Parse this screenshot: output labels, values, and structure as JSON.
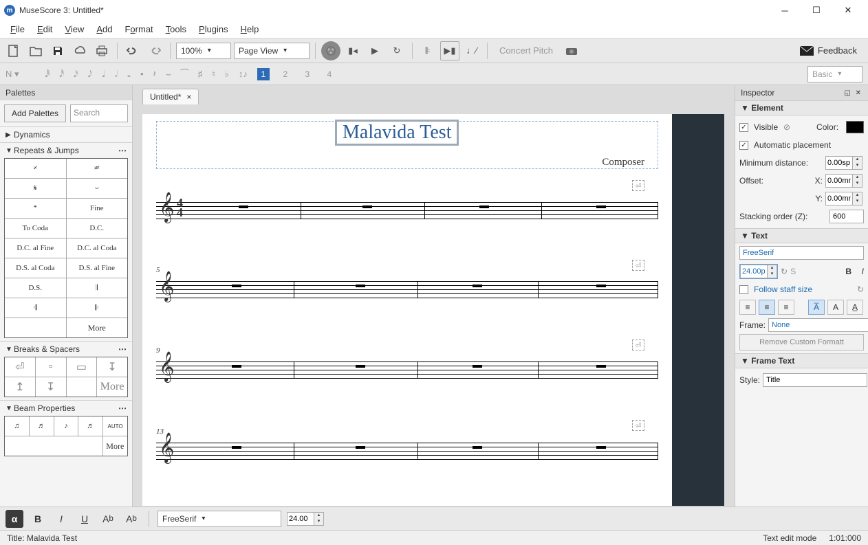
{
  "title": "MuseScore 3: Untitled*",
  "menu": [
    "File",
    "Edit",
    "View",
    "Add",
    "Format",
    "Tools",
    "Plugins",
    "Help"
  ],
  "zoom": "100%",
  "viewMode": "Page View",
  "concertPitch": "Concert Pitch",
  "feedback": "Feedback",
  "noteStyle": "Basic",
  "voices": [
    "1",
    "2",
    "3",
    "4"
  ],
  "tabs": [
    {
      "label": "Untitled*"
    }
  ],
  "score": {
    "title": "Malavida Test",
    "composer": "Composer",
    "staves": [
      {
        "num": "",
        "timesig": true
      },
      {
        "num": "5"
      },
      {
        "num": "9"
      },
      {
        "num": "13"
      }
    ]
  },
  "palettes": {
    "title": "Palettes",
    "addBtn": "Add Palettes",
    "searchPlaceholder": "Search",
    "dynamics": "Dynamics",
    "repeats": {
      "title": "Repeats & Jumps",
      "cells": [
        [
          "𝄎",
          "𝄏"
        ],
        [
          "𝄋",
          "𝄑"
        ],
        [
          "𝄌",
          "Fine"
        ],
        [
          "To Coda",
          "D.C."
        ],
        [
          "D.C. al Fine",
          "D.C. al Coda"
        ],
        [
          "D.S. al Coda",
          "D.S. al Fine"
        ],
        [
          "D.S.",
          "𝄂"
        ],
        [
          "𝄇",
          "𝄆"
        ]
      ],
      "more": "More"
    },
    "breaks": {
      "title": "Breaks & Spacers",
      "more": "More"
    },
    "beam": {
      "title": "Beam Properties",
      "auto": "AUTO",
      "more": "More"
    }
  },
  "inspector": {
    "title": "Inspector",
    "element": "Element",
    "visible": "Visible",
    "colorLabel": "Color:",
    "autoPlacement": "Automatic placement",
    "minDist": "Minimum distance:",
    "minDistVal": "0.00sp",
    "offset": "Offset:",
    "xLabel": "X:",
    "xVal": "0.00mm",
    "yLabel": "Y:",
    "yVal": "0.00mm",
    "stacking": "Stacking order (Z):",
    "stackingVal": "600",
    "textSection": "Text",
    "font": "FreeSerif",
    "fontSize": "24.00p",
    "followStaff": "Follow staff size",
    "frameLabel": "Frame:",
    "frameVal": "None",
    "removeBtn": "Remove Custom Formatt",
    "frameText": "Frame Text",
    "styleLabel": "Style:",
    "styleVal": "Title"
  },
  "textToolbar": {
    "font": "FreeSerif",
    "size": "24.00"
  },
  "status": {
    "left": "Title: Malavida Test",
    "mode": "Text edit mode",
    "time": "1:01:000"
  }
}
